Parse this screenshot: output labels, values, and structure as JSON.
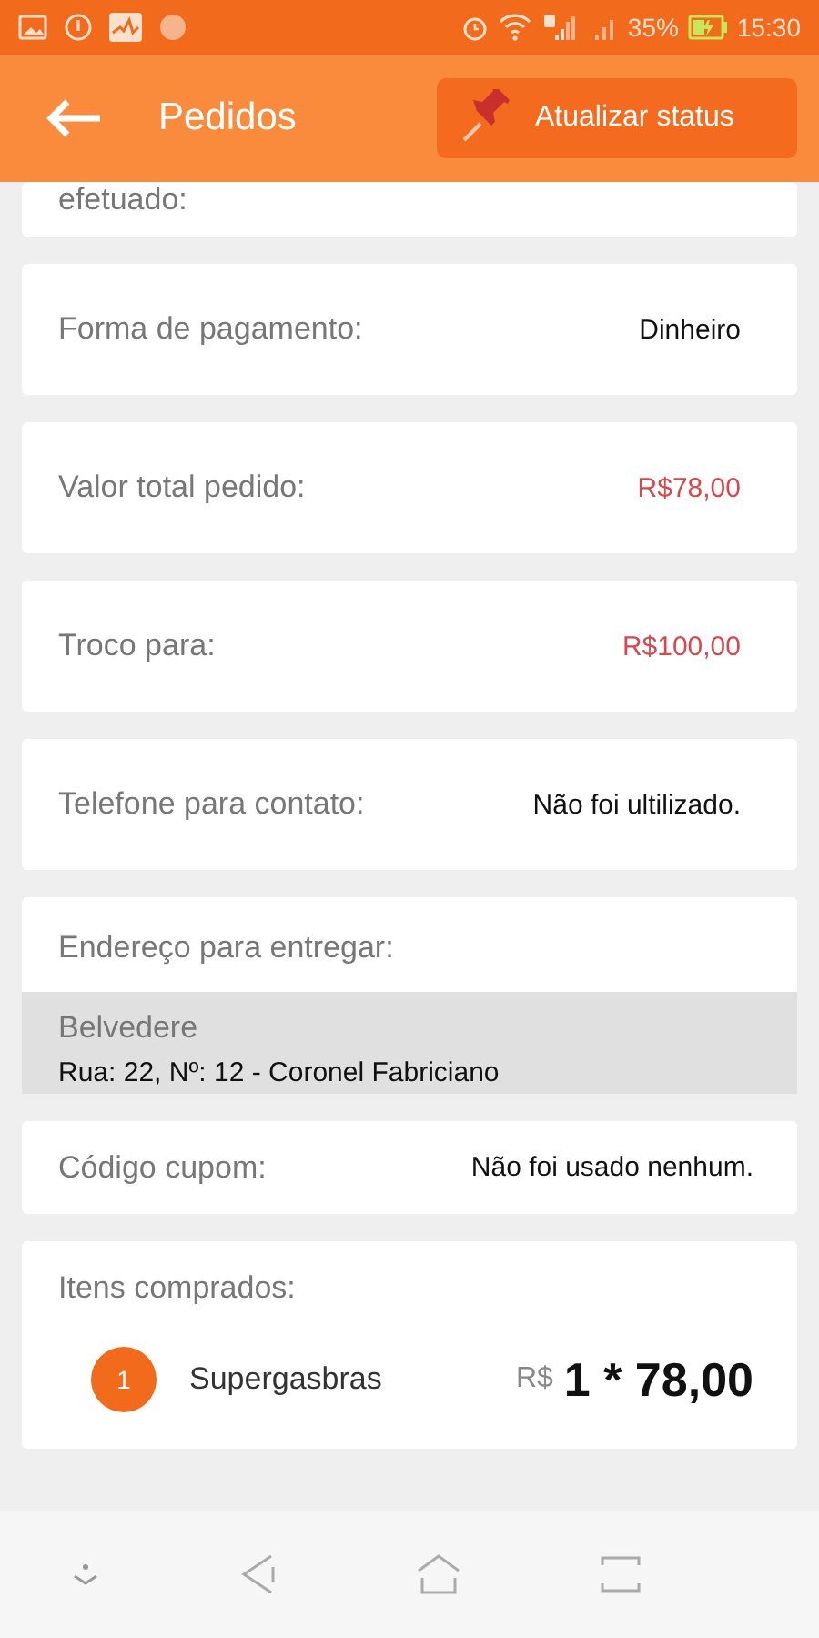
{
  "status_bar": {
    "battery": "35%",
    "time": "15:30"
  },
  "app_bar": {
    "title": "Pedidos",
    "action": "Atualizar status"
  },
  "partial_field": {
    "label": "efetuado:"
  },
  "fields": [
    {
      "label": "Forma de pagamento:",
      "value": "Dinheiro",
      "kind": "text"
    },
    {
      "label": "Valor total pedido:",
      "value": "R$78,00",
      "kind": "price"
    },
    {
      "label": "Troco para:",
      "value": "R$100,00",
      "kind": "price"
    },
    {
      "label": "Telefone para contato:",
      "value": "Não foi ultilizado.",
      "kind": "text"
    }
  ],
  "address": {
    "label": "Endereço para entregar:",
    "name": "Belvedere",
    "line": "Rua: 22, Nº: 12 - Coronel Fabriciano"
  },
  "coupon": {
    "label": "Código cupom:",
    "value": "Não foi usado nenhum."
  },
  "items": {
    "label": "Itens comprados:",
    "list": [
      {
        "index": "1",
        "name": "Supergasbras",
        "currency": "R$",
        "amount": "1 * 78,00"
      }
    ]
  }
}
